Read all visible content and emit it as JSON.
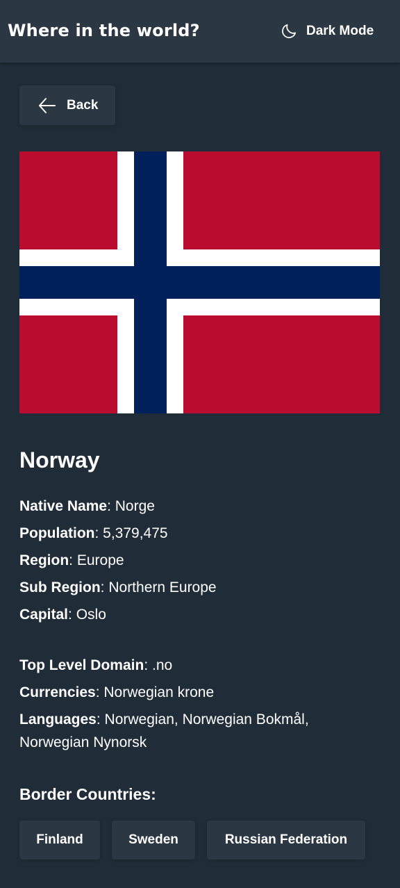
{
  "header": {
    "title": "Where in the world?",
    "mode_label": "Dark Mode",
    "mode_icon": "moon-icon"
  },
  "back_button": {
    "label": "Back",
    "icon": "arrow-left-icon"
  },
  "flag": {
    "colors": {
      "red": "#ba0c2f",
      "white": "#ffffff",
      "blue": "#00205b"
    }
  },
  "country": {
    "name": "Norway",
    "native_name": {
      "label": "Native Name",
      "value": "Norge"
    },
    "population": {
      "label": "Population",
      "value": "5,379,475"
    },
    "region": {
      "label": "Region",
      "value": "Europe"
    },
    "sub_region": {
      "label": "Sub Region",
      "value": "Northern Europe"
    },
    "capital": {
      "label": "Capital",
      "value": "Oslo"
    },
    "top_level_domain": {
      "label": "Top Level Domain",
      "value": ".no"
    },
    "currencies": {
      "label": "Currencies",
      "value": "Norwegian krone"
    },
    "languages": {
      "label": "Languages",
      "value_line1": "Norwegian, Norwegian Bokmål,",
      "value_line2": "Norwegian Nynorsk"
    }
  },
  "border_countries": {
    "title": "Border Countries:",
    "items": [
      "Finland",
      "Sweden",
      "Russian Federation"
    ]
  },
  "theme": {
    "background": "#202c37",
    "element": "#2b3743",
    "text": "#ffffff"
  }
}
